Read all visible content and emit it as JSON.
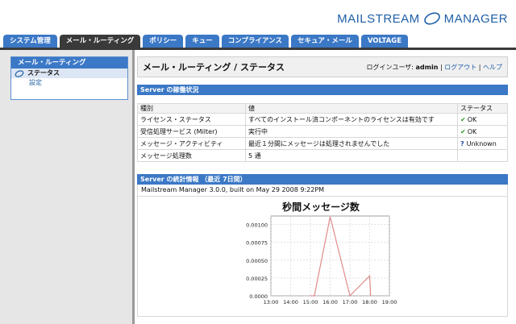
{
  "logo": {
    "text": "MAILSTREAM MANAGER"
  },
  "tabs": [
    {
      "label": "システム管理",
      "active": false
    },
    {
      "label": "メール・ルーティング",
      "active": true
    },
    {
      "label": "ポリシー",
      "active": false
    },
    {
      "label": "キュー",
      "active": false
    },
    {
      "label": "コンプライアンス",
      "active": false
    },
    {
      "label": "セキュア・メール",
      "active": false
    },
    {
      "label": "VOLTAGE",
      "active": false
    }
  ],
  "sidebar": {
    "header": "メール・ルーティング",
    "items": [
      {
        "label": "ステータス",
        "active": true
      },
      {
        "label": "設定",
        "active": false
      }
    ]
  },
  "page": {
    "title": "メール・ルーティング / ステータス",
    "login_label": "ログインユーザ: ",
    "user": "admin",
    "logout": "ログアウト",
    "help": "ヘルプ"
  },
  "status_section": {
    "header": "Server の稼働状況",
    "columns": [
      "種別",
      "値",
      "ステータス"
    ],
    "rows": [
      {
        "type": "ライセンス・ステータス",
        "value": "すべてのインストール済コンポーネントのライセンスは有効です",
        "status": "OK",
        "icon": "check-icon"
      },
      {
        "type": "受信処理サービス (Milter)",
        "value": "実行中",
        "status": "OK",
        "icon": "check-icon"
      },
      {
        "type": "メッセージ・アクティビティ",
        "value": "最近１分間にメッセージは処理されませんでした",
        "status": "Unknown",
        "icon": "question-icon"
      },
      {
        "type": "メッセージ処理数",
        "value": "5 通",
        "status": "",
        "icon": ""
      }
    ]
  },
  "stats_section": {
    "header": "Server の統計情報 （最近 7日間）",
    "build": "Mailstream Manager 3.0.0, built on May 29 2008 9:22PM"
  },
  "colors": {
    "tab": "#3b78c6",
    "tab_active": "#3a3a3a",
    "line": "#e08a8a"
  },
  "chart_data": {
    "type": "line",
    "title": "秒間メッセージ数",
    "xlabel": "",
    "ylabel": "",
    "x_ticks": [
      "13:00",
      "14:00",
      "15:00",
      "16:00",
      "17:00",
      "18:00",
      "19:00"
    ],
    "y_ticks": [
      "0.0000",
      "0.00025",
      "0.00050",
      "0.00075",
      "0.00100"
    ],
    "xlim": [
      13,
      19
    ],
    "ylim": [
      0,
      0.00112
    ],
    "grid": true,
    "series": [
      {
        "x": [
          15.0,
          15.2,
          16.0,
          17.0,
          18.0,
          18.05
        ],
        "y": [
          0,
          0,
          0.00111,
          0,
          0.00028,
          0
        ]
      }
    ]
  }
}
